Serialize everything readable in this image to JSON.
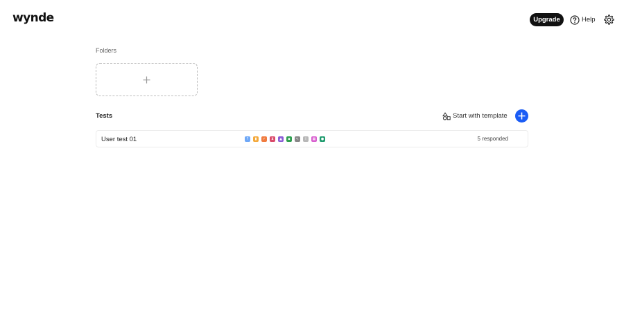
{
  "header": {
    "logo": "wynde",
    "upgrade_label": "Upgrade",
    "help_label": "Help"
  },
  "folders": {
    "section_label": "Folders"
  },
  "tests": {
    "section_label": "Tests",
    "template_label": "Start with template",
    "items": [
      {
        "name": "User test 01",
        "status": "5 responded",
        "blocks": [
          {
            "icon": "question-icon",
            "color": "#6fa8f7",
            "glyph": "?"
          },
          {
            "icon": "bar-chart-icon",
            "color": "#f4a93b",
            "glyph": "▮"
          },
          {
            "icon": "checkbox-icon",
            "color": "#f07b3f",
            "glyph": "✓"
          },
          {
            "icon": "hourglass-icon",
            "color": "#d94a6a",
            "glyph": "⧗"
          },
          {
            "icon": "image-icon",
            "color": "#8a5cd6",
            "glyph": "▲"
          },
          {
            "icon": "card-icon",
            "color": "#2e9e4f",
            "glyph": "▪"
          },
          {
            "icon": "pointer-icon",
            "color": "#888888",
            "glyph": "↖"
          },
          {
            "icon": "info-icon",
            "color": "#b8b8b8",
            "glyph": "i"
          },
          {
            "icon": "grid-icon",
            "color": "#d85fcf",
            "glyph": "▦"
          },
          {
            "icon": "record-icon",
            "color": "#1f9b6e",
            "glyph": "●"
          }
        ]
      }
    ]
  },
  "colors": {
    "accent": "#1a5cf5",
    "upgrade_bg": "#111111"
  }
}
